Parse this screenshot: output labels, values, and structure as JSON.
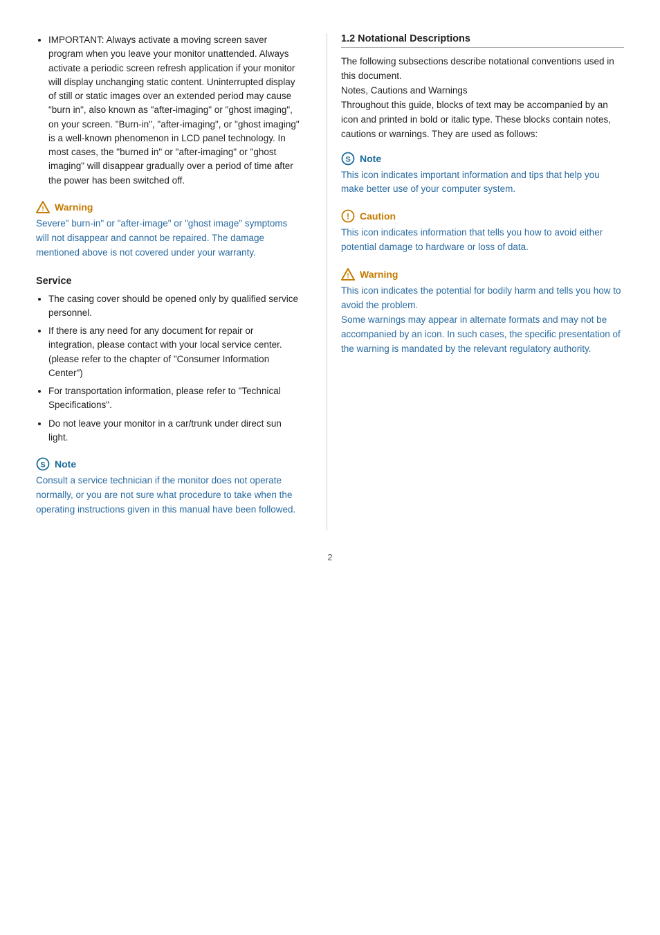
{
  "left_col": {
    "bullet_intro": {
      "items": [
        "IMPORTANT: Always activate a moving screen saver program when you leave your monitor unattended. Always activate a periodic screen refresh application if your monitor will display unchanging static content. Uninterrupted display of still or static images over an extended period may cause \"burn in\", also known as \"after-imaging\" or \"ghost imaging\", on your screen. \"Burn-in\", \"after-imaging\", or \"ghost imaging\" is a well-known phenomenon in LCD panel technology. In most cases, the \"burned in\" or \"after-imaging\" or \"ghost imaging\" will disappear gradually over a period of time after the power has been switched off."
      ]
    },
    "warning1": {
      "label": "Warning",
      "text": "Severe\" burn-in\" or \"after-image\" or \"ghost image\" symptoms will not disappear and cannot be repaired. The damage mentioned above is not covered under your warranty."
    },
    "service_title": "Service",
    "service_items": [
      "The casing cover should be opened only by qualified service personnel.",
      "If there is any need for any document for repair or integration, please contact with your local service center. (please refer to the chapter of \"Consumer Information Center\")",
      "For transportation information, please refer to \"Technical Specifications\".",
      "Do not leave your monitor in a car/trunk under direct sun light."
    ],
    "note1": {
      "label": "Note",
      "text": "Consult a service technician if the monitor does not operate normally, or you are not sure what procedure to take when the operating instructions given in this manual have been followed."
    }
  },
  "right_col": {
    "section_title": "1.2 Notational Descriptions",
    "intro_text": "The following subsections describe notational conventions used in this document.\nNotes, Cautions and Warnings\nThroughout this guide, blocks of text may be accompanied by an icon and printed in bold or italic type. These blocks contain notes, cautions or warnings. They are used as follows:",
    "note_box": {
      "label": "Note",
      "text": "This icon indicates important information and tips that help you make better use of your computer system."
    },
    "caution_box": {
      "label": "Caution",
      "text": "This icon indicates information that tells you how to avoid either potential damage to hardware or loss of data."
    },
    "warning_box": {
      "label": "Warning",
      "text": "This icon indicates the potential for bodily harm and tells you how to avoid the problem.\nSome warnings may appear in alternate formats and may not be accompanied by an icon. In such cases, the specific presentation of the warning is mandated by the relevant regulatory authority."
    }
  },
  "page_number": "2"
}
